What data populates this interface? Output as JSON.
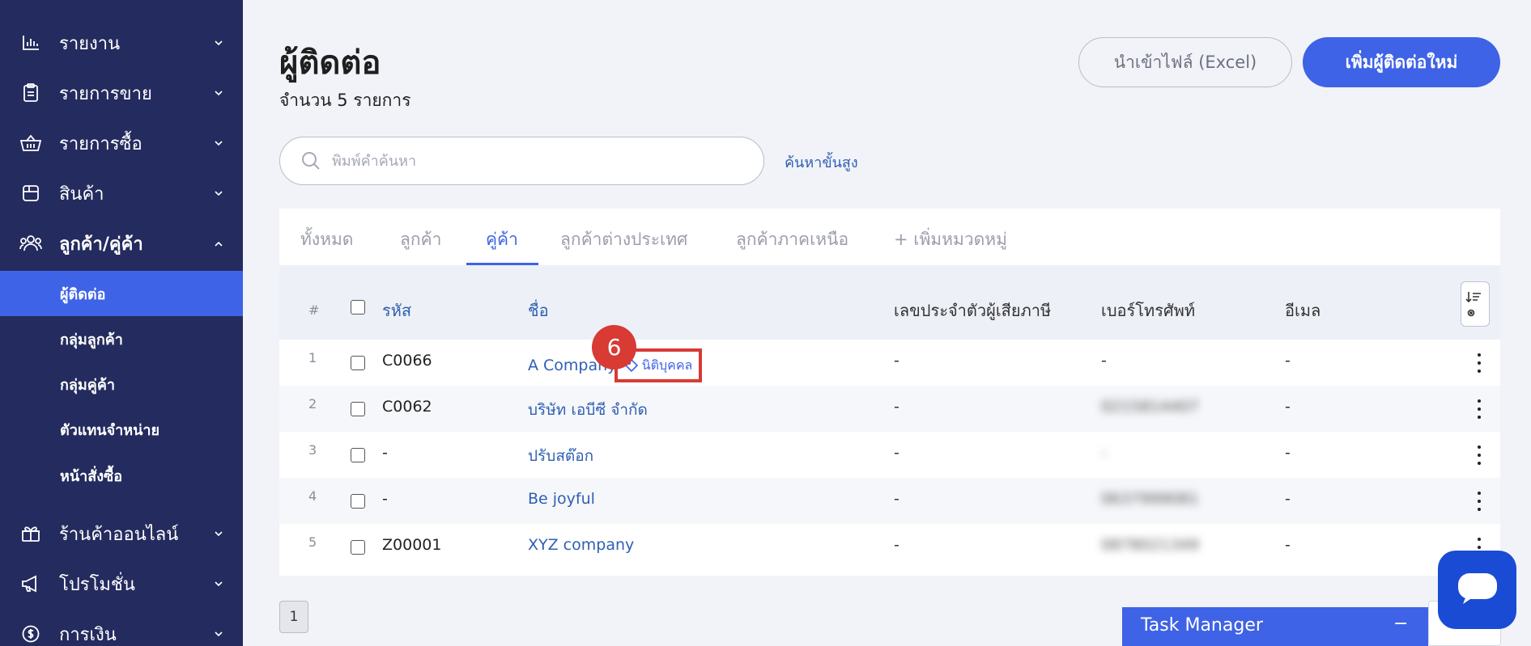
{
  "sidebar": {
    "items": [
      {
        "label": "รายงาน",
        "icon": "bar-chart-icon"
      },
      {
        "label": "รายการขาย",
        "icon": "clipboard-icon"
      },
      {
        "label": "รายการซื้อ",
        "icon": "basket-icon"
      },
      {
        "label": "สินค้า",
        "icon": "box-icon"
      },
      {
        "label": "ลูกค้า/คู่ค้า",
        "icon": "users-icon"
      },
      {
        "label": "ร้านค้าออนไลน์",
        "icon": "gift-icon"
      },
      {
        "label": "โปรโมชั่น",
        "icon": "megaphone-icon"
      },
      {
        "label": "การเงิน",
        "icon": "dollar-icon"
      }
    ],
    "sub_items": [
      "ผู้ติดต่อ",
      "กลุ่มลูกค้า",
      "กลุ่มคู่ค้า",
      "ตัวแทนจำหน่าย",
      "หน้าสั่งซื้อ"
    ]
  },
  "header": {
    "title": "ผู้ติดต่อ",
    "count_text": "จำนวน 5 รายการ",
    "import_label": "นำเข้าไฟล์ (Excel)",
    "add_label": "เพิ่มผู้ติดต่อใหม่"
  },
  "search": {
    "placeholder": "พิมพ์คำค้นหา",
    "value": "",
    "advanced_label": "ค้นหาขั้นสูง"
  },
  "tabs": [
    "ทั้งหมด",
    "ลูกค้า",
    "คู่ค้า",
    "ลูกค้าต่างประเทศ",
    "ลูกค้าภาคเหนือ",
    "+ เพิ่มหมวดหมู่"
  ],
  "active_tab": "คู่ค้า",
  "table": {
    "columns": [
      "#",
      "รหัส",
      "ชื่อ",
      "เลขประจำตัวผู้เสียภาษี",
      "เบอร์โทรศัพท์",
      "อีเมล"
    ],
    "rows": [
      {
        "num": "1",
        "code": "C0066",
        "name": "A Company",
        "tax": "-",
        "phone": "-",
        "email": "-"
      },
      {
        "num": "2",
        "code": "C0062",
        "name": "บริษัท เอบีซี จำกัด",
        "tax": "-",
        "phone": "0215814407",
        "email": "-"
      },
      {
        "num": "3",
        "code": "-",
        "name": "ปรับสต๊อก",
        "tax": "-",
        "phone": "-",
        "email": "-"
      },
      {
        "num": "4",
        "code": "-",
        "name": "Be joyful",
        "tax": "-",
        "phone": "0637999081",
        "email": "-"
      },
      {
        "num": "5",
        "code": "Z00001",
        "name": "XYZ company",
        "tax": "-",
        "phone": "0878021349",
        "email": "-"
      }
    ],
    "tag_label": "นิติบุคคล"
  },
  "annotation": {
    "step": "6"
  },
  "pagination": {
    "current": "1"
  },
  "task_manager": {
    "title": "Task Manager",
    "minimize": "−"
  },
  "colors": {
    "sidebar": "#242b5e",
    "accent": "#3f63e6",
    "link": "#2f5fb3",
    "highlight": "#d83a34"
  }
}
